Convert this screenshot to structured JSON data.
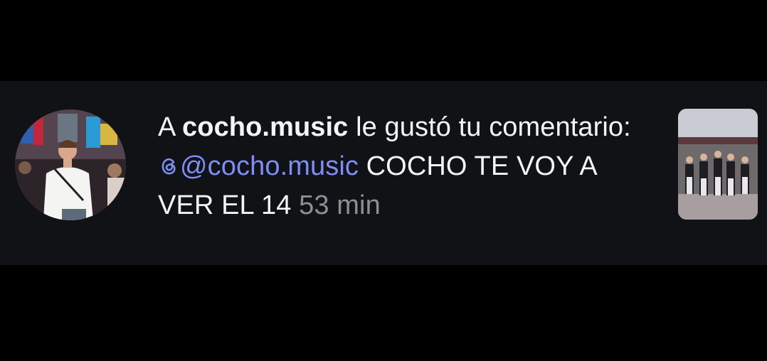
{
  "notification": {
    "prefix": "A",
    "username": "cocho.music",
    "action": "le gustó tu comentario:",
    "mention": "@cocho.music",
    "comment": "COCHO TE VOY A VER EL 14",
    "time": "53 min",
    "avatar_alt": "avatar",
    "thumbnail_alt": "post-thumbnail"
  },
  "colors": {
    "background": "#000000",
    "card": "#101215",
    "text": "#f3f5f7",
    "mention": "#7e8df7",
    "timestamp": "#8c8f94"
  },
  "icons": {
    "mention_icon": "threads-logo-icon"
  }
}
